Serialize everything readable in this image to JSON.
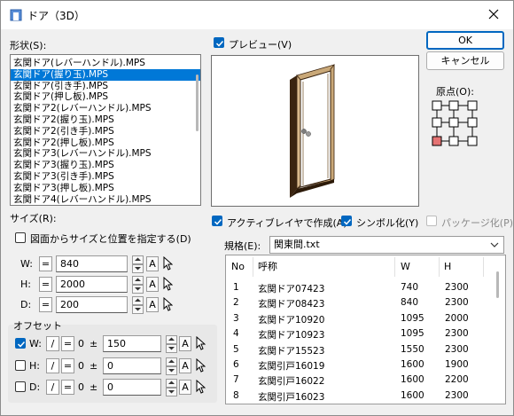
{
  "title": "ドア（3D）",
  "shape_label": "形状(S):",
  "shape_list": [
    "玄関ドア(レバーハンドル).MPS",
    "玄関ドア(握り玉).MPS",
    "玄関ドア(引き手).MPS",
    "玄関ドア(押し板).MPS",
    "玄関ドア2(レバーハンドル).MPS",
    "玄関ドア2(握り玉).MPS",
    "玄関ドア2(引き手).MPS",
    "玄関ドア2(押し板).MPS",
    "玄関ドア3(レバーハンドル).MPS",
    "玄関ドア3(握り玉).MPS",
    "玄関ドア3(引き手).MPS",
    "玄関ドア3(押し板).MPS",
    "玄関ドア4(レバーハンドル).MPS"
  ],
  "shape_selected": 1,
  "preview_label": "プレビュー(V)",
  "ok_label": "OK",
  "cancel_label": "キャンセル",
  "origin_label": "原点(O):",
  "size_label": "サイズ(R):",
  "from_drawing_label": "図面からサイズと位置を指定する(D)",
  "size_rows": [
    {
      "axis": "W:",
      "op": "=",
      "value": "840",
      "unit": "A"
    },
    {
      "axis": "H:",
      "op": "=",
      "value": "2000",
      "unit": "A"
    },
    {
      "axis": "D:",
      "op": "=",
      "value": "200",
      "unit": "A"
    }
  ],
  "offset_label": "オフセット",
  "offset_rows": [
    {
      "axis": "W:",
      "checked": true,
      "div": "/",
      "eq": "=",
      "base": "0",
      "pm": "±",
      "value": "150",
      "unit": "A"
    },
    {
      "axis": "H:",
      "checked": false,
      "div": "/",
      "eq": "=",
      "base": "0",
      "pm": "±",
      "value": "0",
      "unit": "A"
    },
    {
      "axis": "D:",
      "checked": false,
      "div": "/",
      "eq": "=",
      "base": "0",
      "pm": "±",
      "value": "0",
      "unit": "A"
    }
  ],
  "active_layer_label": "アクティブレイヤで作成(A)",
  "symbolize_label": "シンボル化(Y)",
  "package_label": "パッケージ化(P)",
  "spec_label": "規格(E):",
  "spec_value": "関東間.txt",
  "table": {
    "headers": [
      "No",
      "呼称",
      "W",
      "H"
    ],
    "rows": [
      [
        "1",
        "玄関ドア07423",
        "740",
        "2300"
      ],
      [
        "2",
        "玄関ドア08423",
        "840",
        "2300"
      ],
      [
        "3",
        "玄関ドア10920",
        "1095",
        "2000"
      ],
      [
        "4",
        "玄関ドア10923",
        "1095",
        "2300"
      ],
      [
        "5",
        "玄関ドア15523",
        "1550",
        "2300"
      ],
      [
        "6",
        "玄関引戸16019",
        "1600",
        "1900"
      ],
      [
        "7",
        "玄関引戸16022",
        "1600",
        "2200"
      ],
      [
        "8",
        "玄関引戸16023",
        "1600",
        "2300"
      ]
    ]
  },
  "colors": {
    "accent": "#0067c0",
    "selection": "#0078d7",
    "origin_active": "#e57373"
  }
}
